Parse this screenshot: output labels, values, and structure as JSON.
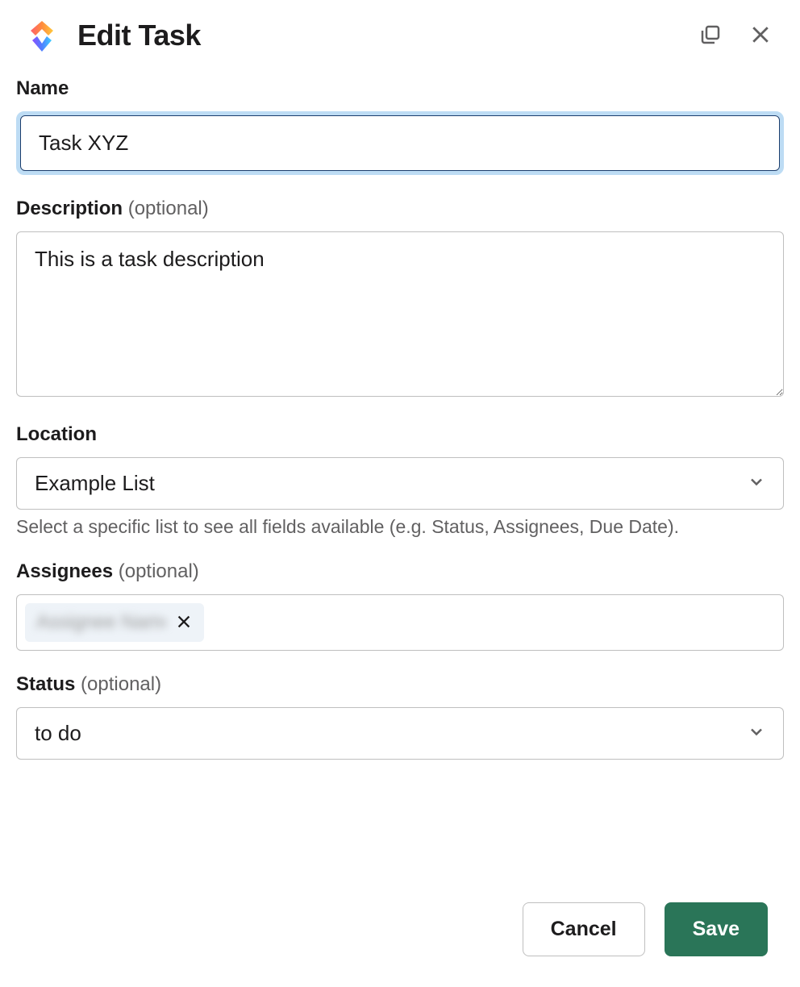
{
  "header": {
    "title": "Edit Task"
  },
  "fields": {
    "name": {
      "label": "Name",
      "value": "Task XYZ"
    },
    "description": {
      "label": "Description",
      "optional": "(optional)",
      "value": "This is a task description"
    },
    "location": {
      "label": "Location",
      "value": "Example List",
      "help": "Select a specific list to see all fields available (e.g. Status, Assignees, Due Date)."
    },
    "assignees": {
      "label": "Assignees",
      "optional": "(optional)",
      "chip": "Assignee Name"
    },
    "status": {
      "label": "Status",
      "optional": "(optional)",
      "value": "to do"
    }
  },
  "footer": {
    "cancel": "Cancel",
    "save": "Save"
  }
}
